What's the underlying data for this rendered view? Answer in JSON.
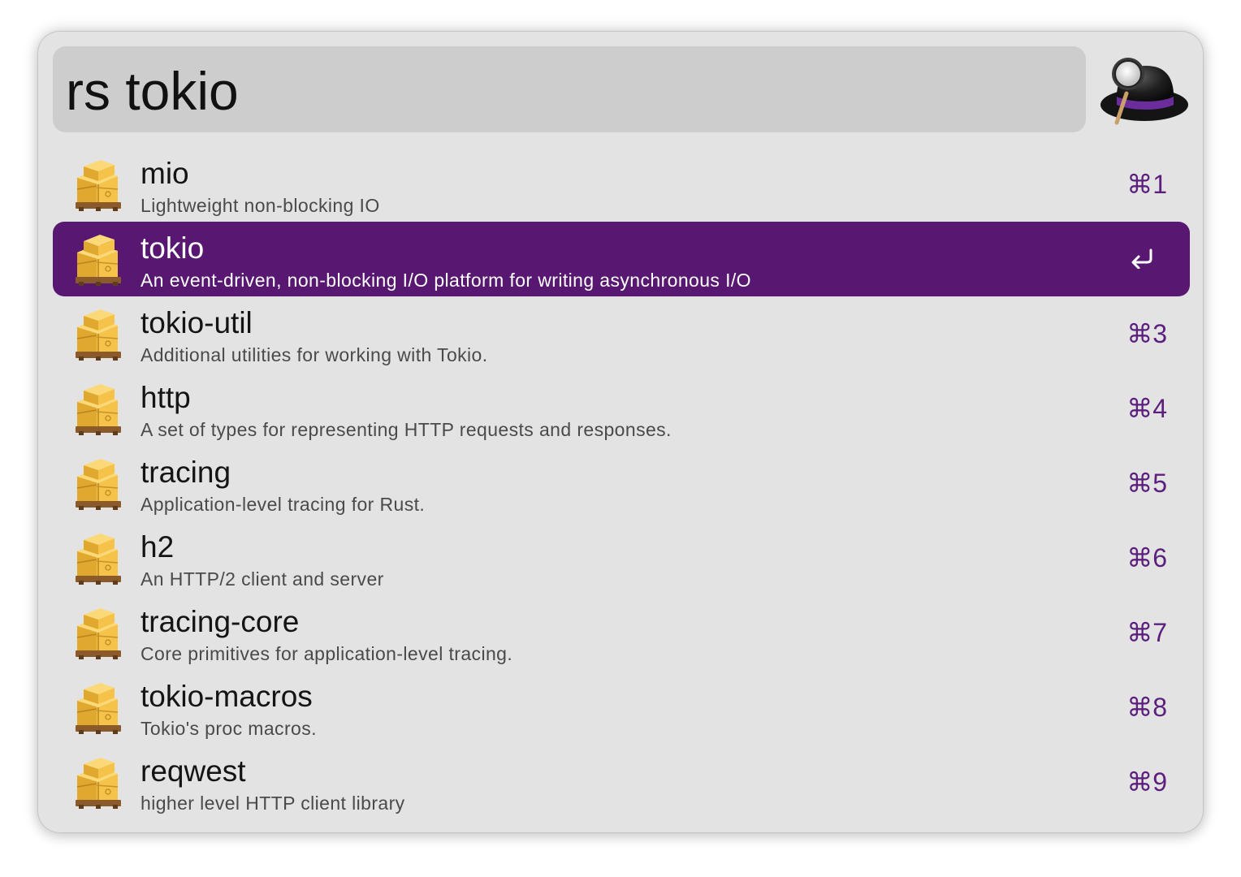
{
  "search": {
    "query": "rs tokio"
  },
  "app": {
    "logo_icon": "alfred-hat-icon"
  },
  "colors": {
    "selected_background": "#581872",
    "shortcut_text": "#5c1f7d",
    "window_background": "#e3e3e3",
    "search_background": "#cdcdcd"
  },
  "results": [
    {
      "title": "mio",
      "subtitle": "Lightweight non-blocking IO",
      "shortcut": "⌘1",
      "icon": "crate-icon"
    },
    {
      "title": "tokio",
      "subtitle": "An event-driven, non-blocking I/O platform for writing asynchronous I/O",
      "shortcut": "↩",
      "icon": "crate-icon",
      "selected": true
    },
    {
      "title": "tokio-util",
      "subtitle": "Additional utilities for working with Tokio.",
      "shortcut": "⌘3",
      "icon": "crate-icon"
    },
    {
      "title": "http",
      "subtitle": "A set of types for representing HTTP requests and responses.",
      "shortcut": "⌘4",
      "icon": "crate-icon"
    },
    {
      "title": "tracing",
      "subtitle": "Application-level tracing for Rust.",
      "shortcut": "⌘5",
      "icon": "crate-icon"
    },
    {
      "title": "h2",
      "subtitle": "An HTTP/2 client and server",
      "shortcut": "⌘6",
      "icon": "crate-icon"
    },
    {
      "title": "tracing-core",
      "subtitle": "Core primitives for application-level tracing.",
      "shortcut": "⌘7",
      "icon": "crate-icon"
    },
    {
      "title": "tokio-macros",
      "subtitle": "Tokio's proc macros.",
      "shortcut": "⌘8",
      "icon": "crate-icon"
    },
    {
      "title": "reqwest",
      "subtitle": "higher level HTTP client library",
      "shortcut": "⌘9",
      "icon": "crate-icon"
    }
  ]
}
